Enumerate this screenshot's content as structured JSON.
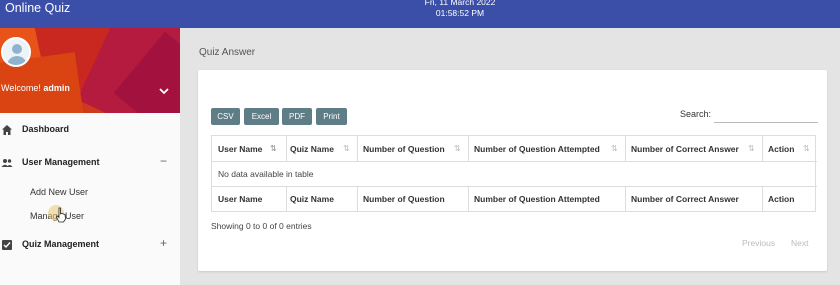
{
  "header": {
    "title": "Online Quiz",
    "date": "Fri, 11 March 2022",
    "time": "01:58:52 PM"
  },
  "profile": {
    "welcome_prefix": "Welcome!",
    "username": "admin"
  },
  "sidebar": {
    "items": [
      {
        "label": "Dashboard",
        "icon": "home-icon"
      },
      {
        "label": "User Management",
        "icon": "people-icon",
        "toggle": "−",
        "sub": [
          "Add New User",
          "Manage User"
        ]
      },
      {
        "label": "Quiz Management",
        "icon": "checkbox-icon",
        "toggle": "+"
      }
    ]
  },
  "page": {
    "title": "Quiz Answer"
  },
  "toolbar": {
    "buttons": [
      "CSV",
      "Excel",
      "PDF",
      "Print"
    ],
    "search_label": "Search:"
  },
  "table": {
    "columns": [
      "User Name",
      "Quiz Name",
      "Number of Question",
      "Number of Question Attempted",
      "Number of Correct Answer",
      "Action"
    ],
    "empty_message": "No data available in table"
  },
  "footer": {
    "info": "Showing 0 to 0 of 0 entries",
    "previous": "Previous",
    "next": "Next"
  },
  "colors": {
    "topbar": "#3b4fa8",
    "button": "#5f7d87",
    "profile_bg": "#d03a1c"
  }
}
